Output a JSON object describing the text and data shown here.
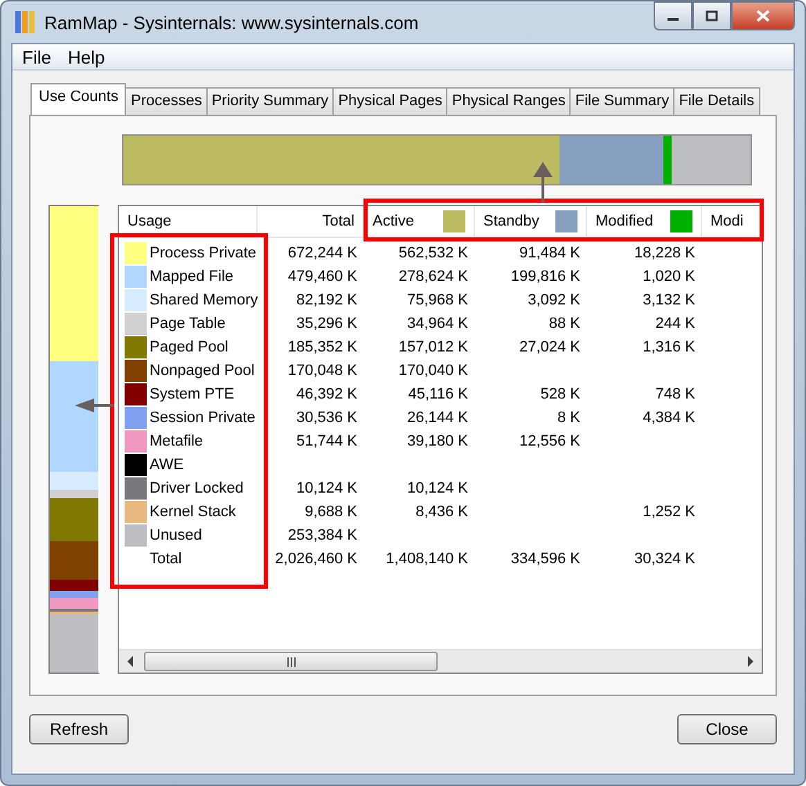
{
  "window": {
    "title": "RamMap - Sysinternals: www.sysinternals.com"
  },
  "menu": [
    "File",
    "Help"
  ],
  "tabs": [
    {
      "label": "Use Counts",
      "selected": true
    },
    {
      "label": "Processes",
      "selected": false
    },
    {
      "label": "Priority Summary",
      "selected": false
    },
    {
      "label": "Physical Pages",
      "selected": false
    },
    {
      "label": "Physical Ranges",
      "selected": false
    },
    {
      "label": "File Summary",
      "selected": false
    },
    {
      "label": "File Details",
      "selected": false
    }
  ],
  "table": {
    "columns": [
      {
        "label": "Usage"
      },
      {
        "label": "Total"
      },
      {
        "label": "Active",
        "color": "#bdbb62"
      },
      {
        "label": "Standby",
        "color": "#869fbf"
      },
      {
        "label": "Modified",
        "color": "#00b000"
      },
      {
        "label": "Modi"
      }
    ],
    "rows": [
      {
        "kind": "usage",
        "color": "#ffff80",
        "cells": [
          "Process Private",
          "672,244 K",
          "562,532 K",
          "91,484 K",
          "18,228 K"
        ]
      },
      {
        "kind": "usage",
        "color": "#b0d8ff",
        "cells": [
          "Mapped File",
          "479,460 K",
          "278,624 K",
          "199,816 K",
          "1,020 K"
        ]
      },
      {
        "kind": "usage",
        "color": "#d8ecff",
        "cells": [
          "Shared Memory",
          "82,192 K",
          "75,968 K",
          "3,092 K",
          "3,132 K"
        ]
      },
      {
        "kind": "usage",
        "color": "#d0d0d0",
        "cells": [
          "Page Table",
          "35,296 K",
          "34,964 K",
          "88 K",
          "244 K"
        ]
      },
      {
        "kind": "usage",
        "color": "#807800",
        "cells": [
          "Paged Pool",
          "185,352 K",
          "157,012 K",
          "27,024 K",
          "1,316 K"
        ]
      },
      {
        "kind": "usage",
        "color": "#804000",
        "cells": [
          "Nonpaged Pool",
          "170,048 K",
          "170,040 K",
          null,
          null
        ]
      },
      {
        "kind": "usage",
        "color": "#800000",
        "cells": [
          "System PTE",
          "46,392 K",
          "45,116 K",
          "528 K",
          "748 K"
        ]
      },
      {
        "kind": "usage",
        "color": "#80a0f0",
        "cells": [
          "Session Private",
          "30,536 K",
          "26,144 K",
          "8 K",
          "4,384 K"
        ]
      },
      {
        "kind": "usage",
        "color": "#f098c0",
        "cells": [
          "Metafile",
          "51,744 K",
          "39,180 K",
          "12,556 K",
          null
        ]
      },
      {
        "kind": "usage",
        "color": "#000000",
        "cells": [
          "AWE",
          null,
          null,
          null,
          null
        ]
      },
      {
        "kind": "usage",
        "color": "#78787c",
        "cells": [
          "Driver Locked",
          "10,124 K",
          "10,124 K",
          null,
          null
        ]
      },
      {
        "kind": "usage",
        "color": "#e8b880",
        "cells": [
          "Kernel Stack",
          "9,688 K",
          "8,436 K",
          null,
          "1,252 K"
        ]
      },
      {
        "kind": "usage",
        "color": "#bcbec2",
        "cells": [
          "Unused",
          "253,384 K",
          null,
          null,
          null
        ]
      },
      {
        "kind": "total",
        "cells": [
          "Total",
          "2,026,460 K",
          "1,408,140 K",
          "334,596 K",
          "30,324 K"
        ]
      }
    ]
  },
  "buttons": [
    "Refresh",
    "Close"
  ]
}
